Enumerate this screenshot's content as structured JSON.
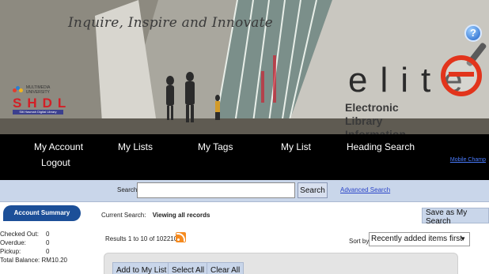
{
  "banner": {
    "tagline": "Inquire, Inspire and Innovate",
    "uni_logo_text": "MULTIMEDIA UNIVERSITY",
    "uni_logo_abbrev": "SHDL",
    "uni_logo_sub": "Siti Hasmah Digital Library",
    "product_word": "elite",
    "product_subtitle_1": "Electronic Library",
    "product_subtitle_2": "Information Tracking Expert",
    "help_symbol": "?"
  },
  "nav": {
    "items": [
      "My Account",
      "My Lists",
      "My Tags",
      "My List",
      "Heading Search"
    ],
    "logout": "Logout",
    "mobile_link": "Mobile Champ"
  },
  "search": {
    "label": "Search",
    "value": "",
    "button": "Search",
    "advanced_link": "Advanced Search"
  },
  "sidebar": {
    "account_summary": "Account Summary",
    "rows": [
      {
        "key": "Checked Out:",
        "value": "0"
      },
      {
        "key": "Overdue:",
        "value": "0"
      },
      {
        "key": "Pickup:",
        "value": "0"
      },
      {
        "key": "Total Balance:",
        "value": "RM10.20"
      }
    ]
  },
  "main": {
    "current_search_label": "Current Search:",
    "current_search_value": "Viewing all records",
    "save_search": "Save as My Search",
    "results_text": "Results 1 to 10 of 102210",
    "sort_label": "Sort by",
    "sort_value": "Recently added items first",
    "actions": [
      "Add to My List",
      "Select All",
      "Clear All"
    ]
  },
  "colors": {
    "nav_bg": "#000000",
    "search_band": "#c9d6ea",
    "account_tab": "#1c4f98",
    "elite_accent": "#e2341c",
    "link": "#2a44c8"
  },
  "icons": {
    "help": "help-icon",
    "rss": "rss-icon",
    "sort_dropdown": "chevron-down-icon"
  }
}
